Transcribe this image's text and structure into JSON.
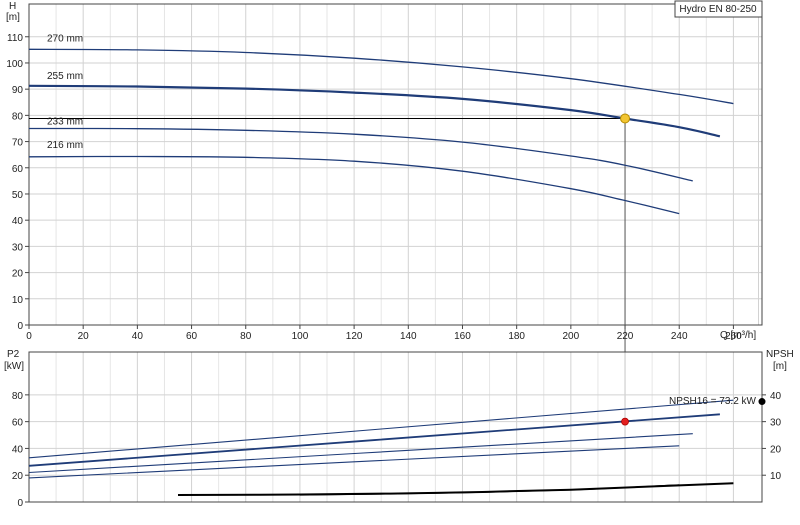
{
  "chart_data": [
    {
      "type": "line",
      "title_box": "Hydro EN 80-250",
      "ylabel_lines": [
        "H",
        "[m]"
      ],
      "xlabel": "Q [m³/h]",
      "xlim": [
        0,
        270
      ],
      "ylim": [
        0,
        120
      ],
      "xticks": [
        0,
        20,
        40,
        60,
        80,
        100,
        120,
        140,
        160,
        180,
        200,
        220,
        240,
        260
      ],
      "yticks": [
        0,
        10,
        20,
        30,
        40,
        50,
        60,
        70,
        80,
        90,
        100,
        110
      ],
      "grid": true,
      "series": [
        {
          "name": "270 mm",
          "x": [
            0,
            40,
            80,
            120,
            160,
            200,
            240,
            260
          ],
          "y": [
            105.2,
            105.0,
            104.0,
            101.8,
            98.5,
            94.0,
            88.0,
            84.5
          ]
        },
        {
          "name": "255 mm",
          "x": [
            0,
            40,
            80,
            120,
            160,
            200,
            220,
            240,
            255
          ],
          "y": [
            91.3,
            91.0,
            90.2,
            88.7,
            86.3,
            82.0,
            78.8,
            75.5,
            72.0
          ]
        },
        {
          "name": "233 mm",
          "x": [
            0,
            40,
            80,
            120,
            160,
            200,
            220,
            245
          ],
          "y": [
            75.0,
            74.9,
            74.3,
            72.8,
            69.8,
            64.5,
            61.0,
            55.0
          ]
        },
        {
          "name": "216 mm",
          "x": [
            0,
            40,
            80,
            120,
            160,
            200,
            220,
            240
          ],
          "y": [
            64.2,
            64.3,
            64.0,
            62.5,
            58.7,
            52.0,
            47.5,
            42.5
          ]
        }
      ],
      "operating_point": {
        "x": 220,
        "y": 78.8
      }
    },
    {
      "type": "line",
      "ylabel_left_lines": [
        "P2",
        "[kW]"
      ],
      "ylabel_right_lines": [
        "NPSH",
        "[m]"
      ],
      "xlim": [
        0,
        270
      ],
      "ylim_left": [
        0,
        100
      ],
      "ylim_right": [
        0,
        50
      ],
      "yticks_left": [
        0,
        20,
        40,
        60,
        80
      ],
      "yticks_right": [
        10,
        20,
        30,
        40
      ],
      "grid": true,
      "annotation": "NPSH16 = 73.2 kW",
      "power_series": [
        {
          "x": [
            0,
            260
          ],
          "y": [
            33,
            76
          ]
        },
        {
          "x": [
            0,
            255
          ],
          "y": [
            27,
            65.5
          ]
        },
        {
          "x": [
            0,
            245
          ],
          "y": [
            22,
            51
          ]
        },
        {
          "x": [
            0,
            240
          ],
          "y": [
            18,
            42
          ]
        }
      ],
      "npsh_series": [
        {
          "x": [
            55,
            100,
            150,
            200,
            240,
            260
          ],
          "y": [
            2.6,
            2.8,
            3.4,
            4.6,
            6.2,
            7.0
          ]
        },
        {
          "x": [
            100,
            150,
            200,
            240
          ],
          "y": [
            2.6,
            3.3,
            4.5,
            6.4
          ]
        }
      ],
      "operating_point_power": {
        "x": 220,
        "y": 60
      },
      "npsh_marker_value": 37.5
    }
  ]
}
